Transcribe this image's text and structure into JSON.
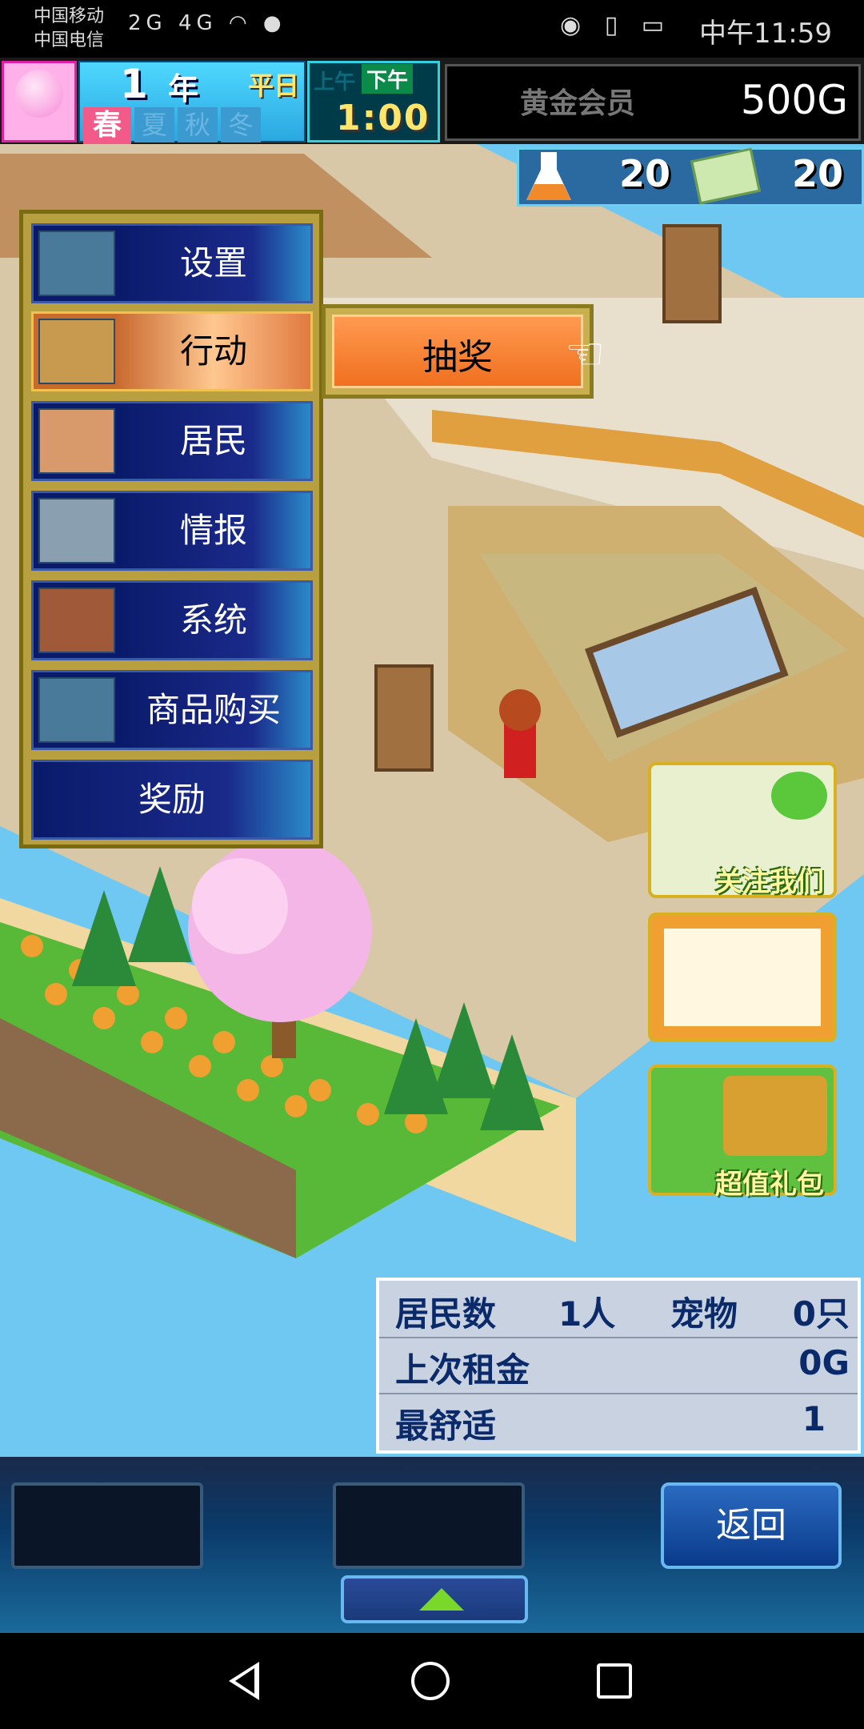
{
  "status_bar": {
    "carrier_1": "中国移动",
    "carrier_2": "中国电信",
    "signal_text": "2G 4G",
    "time": "中午11:59",
    "icons": [
      "eye-icon",
      "vibrate-icon",
      "battery-icon",
      "wifi-icon",
      "chat-icon"
    ]
  },
  "header": {
    "year_number": "1",
    "year_unit": "年",
    "day_type": "平日",
    "season_current": "春",
    "seasons_inactive": [
      "夏",
      "秋",
      "冬"
    ],
    "am_label": "上午",
    "pm_label": "下午",
    "clock": "1:00",
    "membership": "黄金会员",
    "gold": "500G",
    "research_points": "20",
    "tickets": "20"
  },
  "menu": {
    "items": [
      {
        "label": "设置",
        "icon": "building-icon"
      },
      {
        "label": "行动",
        "icon": "bag-icon",
        "active": true
      },
      {
        "label": "居民",
        "icon": "residents-icon"
      },
      {
        "label": "情报",
        "icon": "computer-icon"
      },
      {
        "label": "系统",
        "icon": "tools-icon"
      },
      {
        "label": "商品购买",
        "icon": "building-icon"
      },
      {
        "label": "奖励"
      }
    ],
    "submenu": {
      "label": "抽奖"
    }
  },
  "side_ads": {
    "follow_us": "关注我们",
    "gift_pack": "超值礼包"
  },
  "stats": {
    "residents_label": "居民数",
    "residents_value": "1人",
    "pets_label": "宠物",
    "pets_value": "0只",
    "last_rent_label": "上次租金",
    "last_rent_value": "0G",
    "best_comfort_label": "最舒适",
    "best_comfort_value": "1"
  },
  "bottom": {
    "back_label": "返回"
  },
  "colors": {
    "menu_frame": "#b8a040",
    "menu_item": "#0a1a6a",
    "active_item": "#e07a40",
    "sky": "#6fc8f2"
  }
}
